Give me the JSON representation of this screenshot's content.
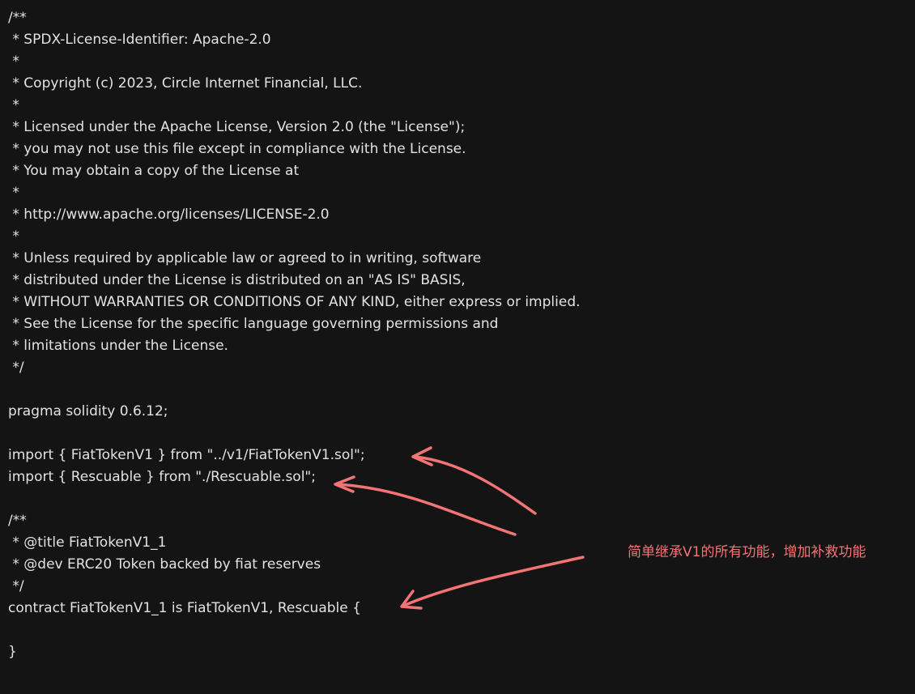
{
  "code": {
    "lines": [
      "/**",
      " * SPDX-License-Identifier: Apache-2.0",
      " *",
      " * Copyright (c) 2023, Circle Internet Financial, LLC.",
      " *",
      " * Licensed under the Apache License, Version 2.0 (the \"License\");",
      " * you may not use this file except in compliance with the License.",
      " * You may obtain a copy of the License at",
      " *",
      " * http://www.apache.org/licenses/LICENSE-2.0",
      " *",
      " * Unless required by applicable law or agreed to in writing, software",
      " * distributed under the License is distributed on an \"AS IS\" BASIS,",
      " * WITHOUT WARRANTIES OR CONDITIONS OF ANY KIND, either express or implied.",
      " * See the License for the specific language governing permissions and",
      " * limitations under the License.",
      " */",
      "",
      "pragma solidity 0.6.12;",
      "",
      "import { FiatTokenV1 } from \"../v1/FiatTokenV1.sol\";",
      "import { Rescuable } from \"./Rescuable.sol\";",
      "",
      "/**",
      " * @title FiatTokenV1_1",
      " * @dev ERC20 Token backed by fiat reserves",
      " */",
      "contract FiatTokenV1_1 is FiatTokenV1, Rescuable {",
      "",
      "}"
    ]
  },
  "annotation": {
    "text": "简单继承V1的所有功能，增加补救功能",
    "color": "#f27474"
  },
  "theme": {
    "background": "#141414",
    "text": "#e2e2e2"
  }
}
